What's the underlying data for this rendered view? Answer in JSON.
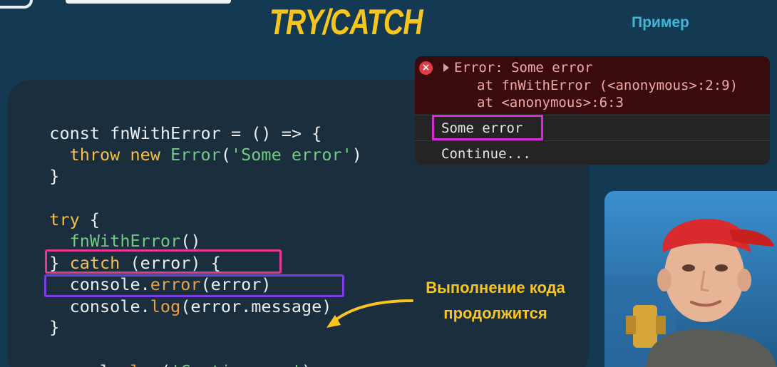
{
  "slide": {
    "title": "TRY/CATCH",
    "subtitle": "Пример"
  },
  "code": {
    "lines": [
      {
        "segments": [
          {
            "text": "const fnWithError = () => {",
            "style": "plain"
          }
        ]
      },
      {
        "segments": [
          {
            "text": "  throw new ",
            "style": "kw"
          },
          {
            "text": "Error",
            "style": "fn"
          },
          {
            "text": "(",
            "style": "plain"
          },
          {
            "text": "'Some error'",
            "style": "str"
          },
          {
            "text": ")",
            "style": "plain"
          }
        ]
      },
      {
        "segments": [
          {
            "text": "}",
            "style": "plain"
          }
        ]
      },
      {
        "segments": [
          {
            "text": "try",
            "style": "kw"
          },
          {
            "text": " {",
            "style": "plain"
          }
        ]
      },
      {
        "segments": [
          {
            "text": "  ",
            "style": "plain"
          },
          {
            "text": "fnWithError",
            "style": "fn"
          },
          {
            "text": "()",
            "style": "plain"
          }
        ]
      },
      {
        "segments": [
          {
            "text": "} ",
            "style": "plain"
          },
          {
            "text": "catch",
            "style": "kw"
          },
          {
            "text": " (error) {",
            "style": "plain"
          }
        ]
      },
      {
        "segments": [
          {
            "text": "  console.",
            "style": "plain"
          },
          {
            "text": "error",
            "style": "method"
          },
          {
            "text": "(error)",
            "style": "plain"
          }
        ]
      },
      {
        "segments": [
          {
            "text": "  console.",
            "style": "plain"
          },
          {
            "text": "log",
            "style": "method"
          },
          {
            "text": "(error.message)",
            "style": "plain"
          }
        ]
      },
      {
        "segments": [
          {
            "text": "}",
            "style": "plain"
          }
        ]
      },
      {
        "segments": [
          {
            "text": "console.",
            "style": "plain"
          },
          {
            "text": "log",
            "style": "method"
          },
          {
            "text": "(",
            "style": "plain"
          },
          {
            "text": "'Continue...'",
            "style": "str"
          },
          {
            "text": ")",
            "style": "plain"
          }
        ]
      }
    ]
  },
  "console": {
    "error_title": "Error: Some error",
    "stack": [
      "at fnWithError (<anonymous>:2:9)",
      "at <anonymous>:6:3"
    ],
    "rows": [
      "Some error",
      "Continue..."
    ]
  },
  "annotation": {
    "line1": "Выполнение кода",
    "line2": "продолжится"
  },
  "colors": {
    "background": "#133a52",
    "code_panel": "#1b2e3e",
    "title": "#f7c51e",
    "keyword": "#f5c04a",
    "function": "#74c985",
    "method": "#e9a049",
    "highlight_pink": "#e63b94",
    "highlight_purple": "#7b3ee6",
    "console_error_bg": "#3a0b0e"
  },
  "icons": {
    "error": "error-circle-icon",
    "expand": "triangle-right-icon",
    "arrow": "curved-arrow-icon"
  }
}
